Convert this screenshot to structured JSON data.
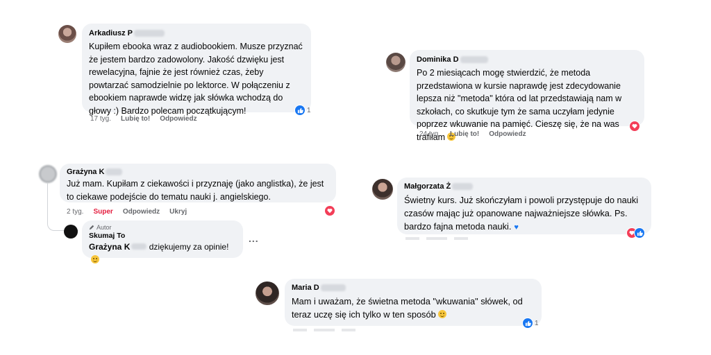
{
  "comments": [
    {
      "name": "Arkadiusz P",
      "text": "Kupiłem ebooka wraz z audiobookiem. Musze przyznać że jestem bardzo zadowolony. Jakość dzwięku jest rewelacyjna, fajnie że jest również czas, żeby powtarzać samodzielnie po lektorce. W połączeniu z ebookiem naprawde widzę jak słówka wchodzą do głowy :) Bardzo polecam początkującym!",
      "time": "17 tyg.",
      "like": "Lubię to!",
      "reply": "Odpowiedz",
      "reaction_count": "1"
    },
    {
      "name": "Dominika D",
      "text": "Po 2 miesiącach mogę stwierdzić, że metoda przedstawiona w kursie naprawdę jest zdecydowanie lepsza niż \"metoda\" która od lat przedstawiają nam w szkołach, co skutkuje tym że sama uczyłam jedynie poprzez wkuwanie na pamięć. Cieszę się, że na was trafiłam",
      "time": "24 tyg.",
      "like": "Lubię to!",
      "reply": "Odpowiedz"
    },
    {
      "name": "Grażyna K",
      "text": "Już mam. Kupiłam z ciekawości i przyznaję (jako anglistka), że jest to ciekawe podejście do tematu nauki j. angielskiego.",
      "time": "2 tyg.",
      "like": "Super",
      "reply": "Odpowiedz",
      "hide": "Ukryj",
      "reply_comment": {
        "badge": "Autor",
        "name": "Skumaj To",
        "mention": "Grażyna K",
        "text": "dziękujemy za opinie!",
        "menu": "..."
      }
    },
    {
      "name": "Małgorzata Ż",
      "text": "Świetny kurs. Już skończyłam i powoli przystępuje do nauki czasów mając już opanowane najważniejsze słówka. Ps. bardzo fajna metoda nauki."
    },
    {
      "name": "Maria D",
      "text": "Mam i uważam, że świetna metoda \"wkuwania\" słówek, od teraz uczę się ich tylko w ten sposób",
      "reaction_count": "1"
    }
  ],
  "colors": {
    "bubble": "#f0f2f5",
    "like": "#1877f2",
    "love": "#f33e58",
    "super": "#e41e3f"
  }
}
